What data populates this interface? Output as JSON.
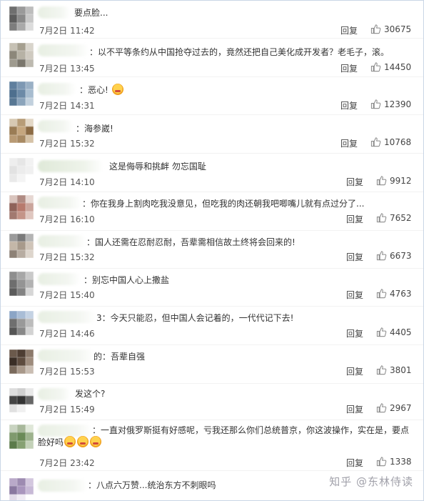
{
  "reply_label": "回复",
  "accent_color": "#c9d6e6",
  "comments": [
    {
      "text": "要点脸...",
      "time": "7月2日 11:42",
      "likes": "30675"
    },
    {
      "text": "：以不平等条约从中国抢夺过去的，竟然还把自己美化成开发者？老毛子，滚。",
      "time": "7月2日 13:45",
      "likes": "14450"
    },
    {
      "text": "：恶心!",
      "time": "7月2日 14:31",
      "likes": "12390"
    },
    {
      "text": "：海参崴!",
      "time": "7月2日 15:32",
      "likes": "10768"
    },
    {
      "text": "这是侮辱和挑衅 勿忘国耻",
      "time": "7月2日 14:10",
      "likes": "9912"
    },
    {
      "text": "：你在我身上割肉吃我没意见，但吃我的肉还朝我吧唧嘴儿就有点过分了...",
      "time": "7月2日 16:10",
      "likes": "7652"
    },
    {
      "text": "：国人还需在忍耐忍耐，吾辈需相信故土终将会回来的!",
      "time": "7月2日 15:32",
      "likes": "6673"
    },
    {
      "text": "：别忘中国人心上撒盐",
      "time": "7月2日 15:40",
      "likes": "4763"
    },
    {
      "text": "3：今天只能忍，但中国人会记着的，一代代记下去!",
      "time": "7月2日 14:46",
      "likes": "4405"
    },
    {
      "text": "的：吾辈自强",
      "time": "7月2日 15:53",
      "likes": "3801"
    },
    {
      "text": "发这个?",
      "time": "7月2日 15:49",
      "likes": "2967"
    },
    {
      "text": "：一直对俄罗斯挺有好感呢，亏我还那么你们总统普京，你这波操作，实在是，要点脸好吗",
      "time": "7月2日 23:42",
      "likes": "1338"
    },
    {
      "text": "：八点六万赞...统治东方不刺眼吗",
      "time": "",
      "likes": ""
    }
  ],
  "watermark": "知乎 @东林侍读"
}
